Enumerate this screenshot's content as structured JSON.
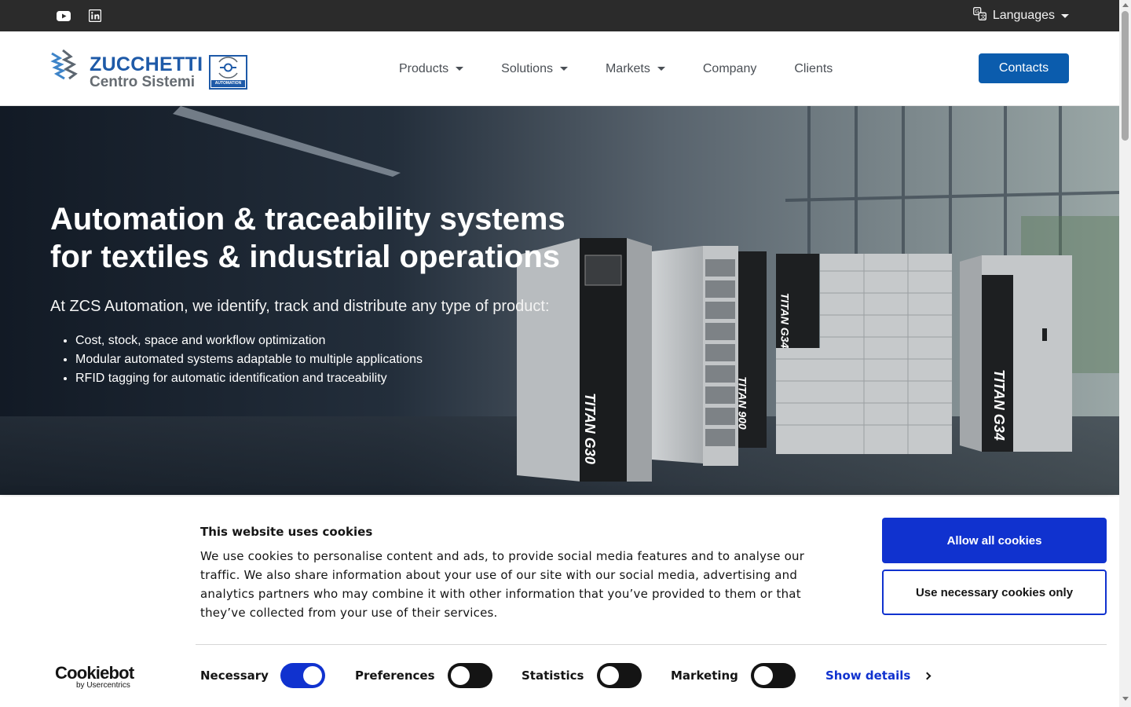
{
  "topbar": {
    "social": [
      {
        "icon": "youtube-icon"
      },
      {
        "icon": "linkedin-icon"
      }
    ],
    "languages_label": "Languages"
  },
  "header": {
    "logo": {
      "line1": "ZUCCHETTI",
      "line2": "Centro Sistemi",
      "badge": "AUTOMATION"
    },
    "nav": [
      {
        "label": "Products",
        "dropdown": true
      },
      {
        "label": "Solutions",
        "dropdown": true
      },
      {
        "label": "Markets",
        "dropdown": true
      },
      {
        "label": "Company",
        "dropdown": false
      },
      {
        "label": "Clients",
        "dropdown": false
      }
    ],
    "contacts_label": "Contacts"
  },
  "hero": {
    "title_line1": "Automation & traceability systems",
    "title_line2": "for textiles & industrial operations",
    "subtitle": "At ZCS Automation, we identify, track and distribute any type of product:",
    "bullets": [
      "Cost, stock, space and workflow optimization",
      "Modular automated systems adaptable to multiple applications",
      "RFID tagging for automatic identification and traceability"
    ],
    "machine_labels": [
      "TITAN G30",
      "TITAN 900",
      "TITAN G34",
      "TITAN G34"
    ]
  },
  "cookie_banner": {
    "title": "This website uses cookies",
    "text": "We use cookies to personalise content and ads, to provide social media features and to analyse our traffic. We also share information about your use of our site with our social media, advertising and analytics partners who may combine it with other information that you’ve provided to them or that they’ve collected from your use of their services.",
    "allow_all_label": "Allow all cookies",
    "necessary_only_label": "Use necessary cookies only",
    "brand": {
      "name": "Cookiebot",
      "byline": "by Usercentrics"
    },
    "toggles": [
      {
        "label": "Necessary",
        "checked": true
      },
      {
        "label": "Preferences",
        "checked": false
      },
      {
        "label": "Statistics",
        "checked": false
      },
      {
        "label": "Marketing",
        "checked": false
      }
    ],
    "show_details_label": "Show details"
  },
  "colors": {
    "topbar_bg": "#2b2b2b",
    "brand_blue": "#0b5cad",
    "cookie_blue": "#1032cf"
  }
}
